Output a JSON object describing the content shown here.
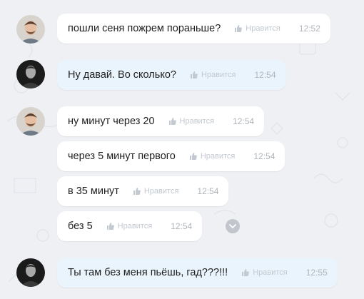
{
  "messages": [
    {
      "text": "пошли сеня пожрем пораньше?",
      "like": "Нравится",
      "time": "12:52"
    },
    {
      "text": "Ну давай. Во сколько?",
      "like": "Нравится",
      "time": "12:54"
    },
    {
      "text": "ну минут через 20",
      "like": "Нравится",
      "time": "12:54"
    },
    {
      "text": "через 5 минут первого",
      "like": "Нравится",
      "time": "12:54"
    },
    {
      "text": "в 35 минут",
      "like": "Нравится",
      "time": "12:54"
    },
    {
      "text": "без 5",
      "like": "Нравится",
      "time": "12:54"
    },
    {
      "text": "Ты там без меня пьёшь, гад???!!!",
      "like": "Нравится",
      "time": "12:55"
    }
  ],
  "icons": {
    "like": "thumbs-up-icon",
    "scroll": "chevron-down-icon"
  },
  "colors": {
    "incoming_bubble": "#ffffff",
    "outgoing_bubble": "#eaf4fd",
    "background": "#eef0f3",
    "meta_text": "#b0b5bb"
  }
}
